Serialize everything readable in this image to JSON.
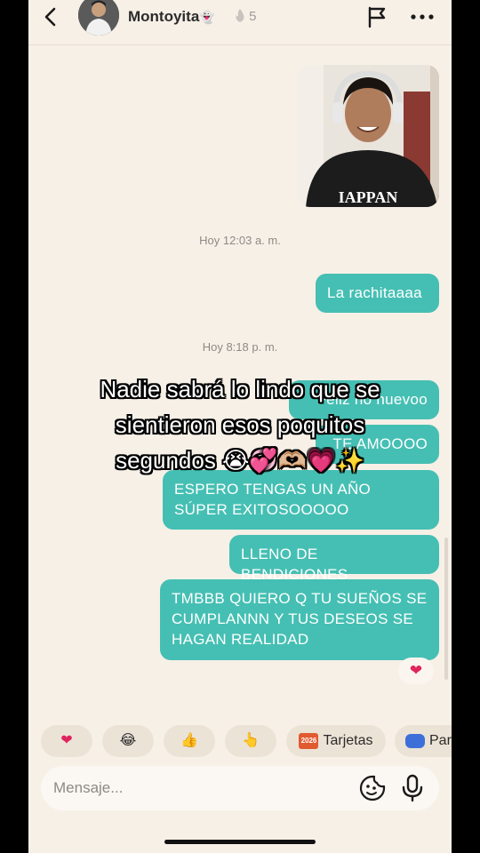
{
  "header": {
    "username": "Montoyita",
    "username_emoji": "👻",
    "streak_icon": "fire-icon",
    "streak_count": "5"
  },
  "messages": {
    "timestamp_1": "Hoy 12:03 a. m.",
    "bubble_1": "La rachitaaaa",
    "timestamp_2": "Hoy 8:18 p. m.",
    "bubble_2": "Feliz no nuevoo",
    "bubble_3": "TE AMOOOO",
    "bubble_4": "ESPERO TENGAS UN AÑO SÚPER EXITOSOOOOO",
    "bubble_5": "LLENO DE BENDICIONES",
    "bubble_6": "TMBBB QUIERO Q TU SUEÑOS SE CUMPLANNN Y TUS DESEOS SE HAGAN REALIDAD",
    "reaction": "❤"
  },
  "caption": {
    "line1": "Nadie sabrá lo lindo que se",
    "line2": "sientieron esos poquitos",
    "line3": "segundos 😭💞🫶🏼💗✨"
  },
  "quick_reactions": {
    "heart": "❤",
    "laugh": "😂",
    "thumbs": "👍",
    "point": "👆",
    "cards_label": "Tarjetas",
    "cards_icon_text": "2026",
    "games_label": "Par"
  },
  "input": {
    "placeholder": "Mensaje..."
  },
  "colors": {
    "bubble": "#45bfb3",
    "background": "#f7f0e7"
  }
}
